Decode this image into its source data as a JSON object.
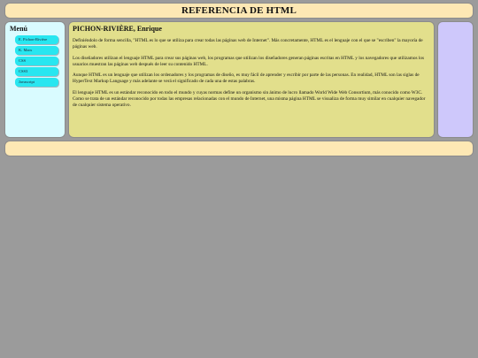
{
  "header": {
    "title": "REFERENCIA DE HTML"
  },
  "sidebar": {
    "title": "Menú",
    "items": [
      {
        "label": "E. Pichon-Rivière"
      },
      {
        "label": "K. Marx"
      },
      {
        "label": "CSS"
      },
      {
        "label": "CSS3"
      },
      {
        "label": "Javascript"
      }
    ]
  },
  "main": {
    "heading": "PICHON-RIVIÈRE, Enrique",
    "paragraphs": [
      "Definiéndolo de forma sencilla, \"HTML es lo que se utiliza para crear todas las páginas web de Internet\". Más concretamente, HTML es el lenguaje con el que se \"escriben\" la mayoría de páginas web.",
      "Los diseñadores utilizan el lenguaje HTML para crear sus páginas web, los programas que utilizan los diseñadores generan páginas escritas en HTML y los navegadores que utilizamos los usuarios muestran las páginas web después de leer su contenido HTML.",
      "Aunque HTML es un lenguaje que utilizan los ordenadores y los programas de diseño, es muy fácil de aprender y escribir por parte de las personas. En realidad, HTML son las siglas de HyperText Markup Language y más adelante se verá el significado de cada una de estas palabras.",
      "El lenguaje HTML es un estándar reconocido en todo el mundo y cuyas normas define un organismo sin ánimo de lucro llamado World Wide Web Consortium, más conocido como W3C. Como se trata de un estándar reconocido por todas las empresas relacionadas con el mundo de Internet, una misma página HTML se visualiza de forma muy similar en cualquier navegador de cualquier sistema operativo."
    ]
  },
  "colors": {
    "page_background": "#9b9b9b",
    "header_footer": "#fde8b4",
    "sidebar": "#d9fbff",
    "menu_item": "#28e6f0",
    "main": "#e2df8c",
    "right_panel": "#cec8fb"
  }
}
